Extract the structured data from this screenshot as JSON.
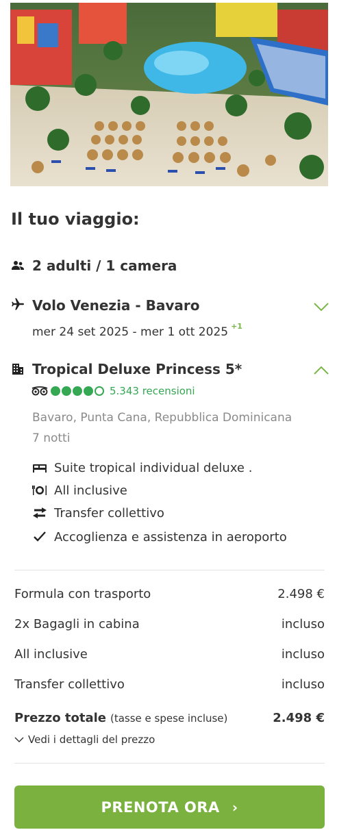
{
  "hero": {
    "image_icon": "resort-pool-beach-photo"
  },
  "summary": {
    "title": "Il tuo viaggio:",
    "pax": {
      "icon": "people-icon",
      "label": "2 adulti / 1 camera"
    },
    "flight": {
      "icon": "airplane-icon",
      "title": "Volo Venezia - Bavaro",
      "dates": "mer 24 set 2025 - mer 1 ott 2025",
      "day_offset": "+1",
      "toggle_icon": "chevron-down-icon"
    },
    "hotel": {
      "icon": "building-icon",
      "title": "Tropical Deluxe Princess 5*",
      "rating": 4,
      "rating_max": 5,
      "reviews": "5.343 recensioni",
      "location": "Bavaro, Punta Cana, Repubblica Dominicana",
      "nights": "7 notti",
      "toggle_icon": "chevron-up-icon",
      "features": [
        {
          "icon": "bed-icon",
          "label": "Suite tropical individual deluxe ."
        },
        {
          "icon": "dining-icon",
          "label": "All inclusive"
        },
        {
          "icon": "transfer-arrows-icon",
          "label": "Transfer collettivo"
        },
        {
          "icon": "check-icon",
          "label": "Accoglienza e assistenza in aeroporto"
        }
      ]
    }
  },
  "price": {
    "rows": [
      {
        "label": "Formula con trasporto",
        "value": "2.498 €"
      },
      {
        "label": "2x Bagagli in cabina",
        "value": "incluso"
      },
      {
        "label": "All inclusive",
        "value": "incluso"
      },
      {
        "label": "Transfer collettivo",
        "value": "incluso"
      }
    ],
    "total_label": "Prezzo totale",
    "total_note": "(tasse e spese incluse)",
    "total_value": "2.498 €",
    "details_link": "Vedi i dettagli del prezzo"
  },
  "cta": {
    "label": "PRENOTA ORA",
    "arrow": "›"
  },
  "colors": {
    "accent": "#7ab13f",
    "rating": "#34a853",
    "chevron": "#7ab648",
    "muted": "#8a8a8a"
  }
}
